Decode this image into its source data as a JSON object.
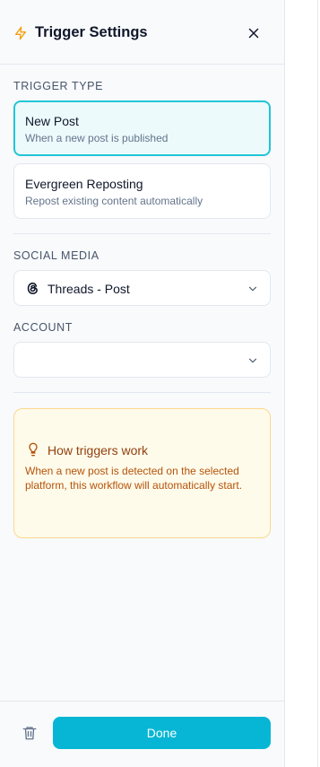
{
  "header": {
    "title": "Trigger Settings",
    "icon": "lightning-bolt-icon",
    "accent": "#f59e0b"
  },
  "trigger_type": {
    "label": "TRIGGER TYPE",
    "options": [
      {
        "title": "New Post",
        "description": "When a new post is published",
        "selected": true
      },
      {
        "title": "Evergreen Reposting",
        "description": "Repost existing content automatically",
        "selected": false
      }
    ]
  },
  "social_media": {
    "label": "SOCIAL MEDIA",
    "value": "Threads - Post",
    "icon": "threads-icon"
  },
  "account": {
    "label": "ACCOUNT",
    "value": ""
  },
  "info": {
    "title": "How triggers work",
    "body": "When a new post is detected on the selected platform, this workflow will automatically start.",
    "icon": "lightbulb-icon"
  },
  "footer": {
    "done_label": "Done",
    "accent": "#06b6d4"
  }
}
